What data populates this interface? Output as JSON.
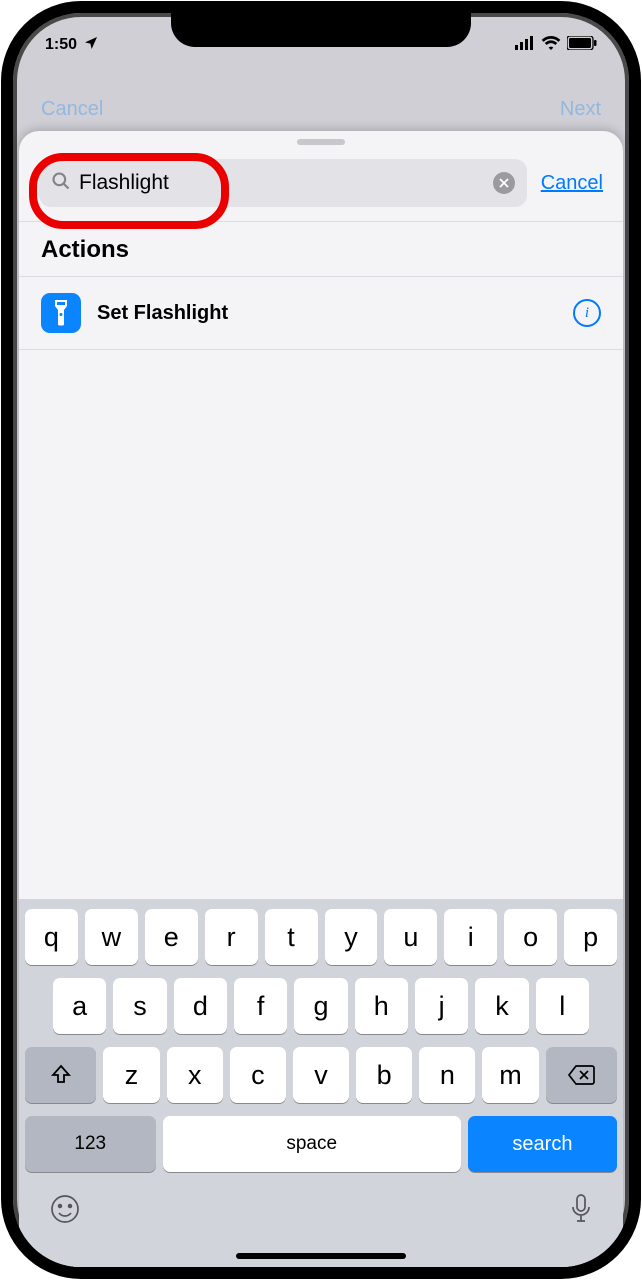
{
  "status": {
    "time": "1:50"
  },
  "dimmed_nav": {
    "left": "Cancel",
    "right": "Next"
  },
  "search": {
    "value": "Flashlight",
    "cancel": "Cancel"
  },
  "section_header": "Actions",
  "actions": [
    {
      "title": "Set Flashlight"
    }
  ],
  "keyboard": {
    "rows": [
      [
        "q",
        "w",
        "e",
        "r",
        "t",
        "y",
        "u",
        "i",
        "o",
        "p"
      ],
      [
        "a",
        "s",
        "d",
        "f",
        "g",
        "h",
        "j",
        "k",
        "l"
      ],
      [
        "z",
        "x",
        "c",
        "v",
        "b",
        "n",
        "m"
      ]
    ],
    "num": "123",
    "space": "space",
    "search": "search"
  }
}
